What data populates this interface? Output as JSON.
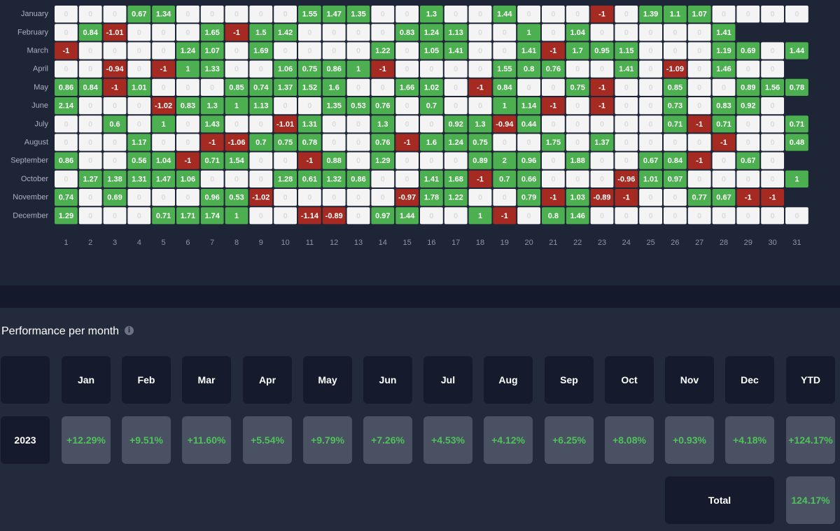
{
  "colors": {
    "positive": "#4caf50",
    "negative": "#a52a22",
    "empty": "#f4f4f4",
    "zero_text": "#dcdcdc",
    "percent_green": "#4fc25a"
  },
  "chart_data": {
    "type": "heatmap",
    "x": [
      "1",
      "2",
      "3",
      "4",
      "5",
      "6",
      "7",
      "8",
      "9",
      "10",
      "11",
      "12",
      "13",
      "14",
      "15",
      "16",
      "17",
      "18",
      "19",
      "20",
      "21",
      "22",
      "23",
      "24",
      "25",
      "26",
      "27",
      "28",
      "29",
      "30",
      "31"
    ],
    "y": [
      "January",
      "February",
      "March",
      "April",
      "May",
      "June",
      "July",
      "August",
      "September",
      "October",
      "November",
      "December"
    ],
    "values": [
      [
        0,
        0,
        0,
        0.67,
        1.34,
        0,
        0,
        0,
        0,
        0,
        1.55,
        1.47,
        1.35,
        0,
        0,
        1.3,
        0,
        0,
        1.44,
        0,
        0,
        0,
        -1,
        0,
        1.39,
        1.1,
        1.07,
        0,
        0,
        0,
        0
      ],
      [
        0,
        0.84,
        -1.01,
        0,
        0,
        0,
        1.65,
        -1,
        1.5,
        1.42,
        0,
        0,
        0,
        0,
        0.83,
        1.24,
        1.13,
        0,
        0,
        1,
        0,
        1.04,
        0,
        0,
        0,
        0,
        0,
        1.41,
        null,
        null,
        null
      ],
      [
        -1,
        0,
        0,
        0,
        0,
        1.24,
        1.07,
        0,
        1.69,
        0,
        0,
        0,
        0,
        1.22,
        0,
        1.05,
        1.41,
        0,
        0,
        1.41,
        -1,
        1.7,
        0.95,
        1.15,
        0,
        0,
        0,
        1.19,
        0.69,
        0,
        1.44
      ],
      [
        0,
        0,
        -0.94,
        0,
        -1,
        1,
        1.33,
        0,
        0,
        1.06,
        0.75,
        0.86,
        1,
        -1,
        0,
        0,
        0,
        0,
        1.55,
        0.8,
        0.76,
        0,
        0,
        1.41,
        0,
        -1.09,
        0,
        1.46,
        0,
        0,
        null
      ],
      [
        0.86,
        0.84,
        -1,
        1.01,
        0,
        0,
        0,
        0.85,
        0.74,
        1.37,
        1.52,
        1.6,
        0,
        0,
        1.66,
        1.02,
        0,
        -1,
        0.84,
        0,
        0,
        0.75,
        -1,
        0,
        0,
        0.85,
        0,
        0,
        0.89,
        1.56,
        0.78
      ],
      [
        2.14,
        0,
        0,
        0,
        -1.02,
        0.83,
        1.3,
        1,
        1.13,
        0,
        0,
        1.35,
        0.53,
        0.76,
        0,
        0.7,
        0,
        0,
        1,
        1.14,
        -1,
        0,
        -1,
        0,
        0,
        0.73,
        0,
        0.83,
        0.92,
        0,
        null
      ],
      [
        0,
        0,
        0.6,
        0,
        1,
        0,
        1.43,
        0,
        0,
        -1.01,
        1.31,
        0,
        0,
        1.3,
        0,
        0,
        0.92,
        1.3,
        -0.94,
        0.44,
        0,
        0,
        0,
        0,
        0,
        0.71,
        -1,
        0.71,
        0,
        0,
        0.71
      ],
      [
        0,
        0,
        0,
        1.17,
        0,
        0,
        -1,
        -1.06,
        0.7,
        0.75,
        0.78,
        0,
        0,
        0.76,
        -1,
        1.6,
        1.24,
        0.75,
        0,
        0,
        1.75,
        0,
        1.37,
        0,
        0,
        0,
        0,
        -1,
        0,
        0,
        0.48
      ],
      [
        0.86,
        0,
        0,
        0.56,
        1.04,
        -1,
        0.71,
        1.54,
        0,
        0,
        -1,
        0.88,
        0,
        1.29,
        0,
        0,
        0,
        0.89,
        2,
        0.96,
        0,
        1.88,
        0,
        0,
        0.67,
        0.84,
        -1,
        0,
        0.67,
        0,
        null
      ],
      [
        0,
        1.27,
        1.38,
        1.31,
        1.47,
        1.06,
        0,
        0,
        0,
        1.28,
        0.61,
        1.32,
        0.86,
        0,
        0,
        1.41,
        1.68,
        -1,
        0.7,
        0.66,
        0,
        0,
        0,
        -0.96,
        1.01,
        0.97,
        0,
        0,
        0,
        0,
        1
      ],
      [
        0.74,
        0,
        0.69,
        0,
        0,
        0,
        0.96,
        0.53,
        -1.02,
        0,
        0,
        0,
        0,
        0,
        -0.97,
        1.78,
        1.22,
        0,
        0,
        0.79,
        -1,
        1.03,
        -0.89,
        -1,
        0,
        0,
        0.77,
        0.67,
        -1,
        -1,
        null
      ],
      [
        1.29,
        0,
        0,
        0,
        0.71,
        1.71,
        1.74,
        1,
        0,
        0,
        -1.14,
        -0.89,
        0,
        0.97,
        1.44,
        0,
        0,
        1,
        -1,
        0,
        0.8,
        1.46,
        0,
        0,
        0,
        0,
        0,
        0,
        0,
        0,
        0
      ]
    ]
  },
  "performance": {
    "title": "Performance per month",
    "info_icon": "info-icon",
    "headers": [
      "Jan",
      "Feb",
      "Mar",
      "Apr",
      "May",
      "Jun",
      "Jul",
      "Aug",
      "Sep",
      "Oct",
      "Nov",
      "Dec",
      "YTD"
    ],
    "year": "2023",
    "values": [
      "+12.29%",
      "+9.51%",
      "+11.60%",
      "+5.54%",
      "+9.79%",
      "+7.26%",
      "+4.53%",
      "+4.12%",
      "+6.25%",
      "+8.08%",
      "+0.93%",
      "+4.18%",
      "+124.17%"
    ],
    "total_label": "Total",
    "total_value": "124.17%"
  }
}
